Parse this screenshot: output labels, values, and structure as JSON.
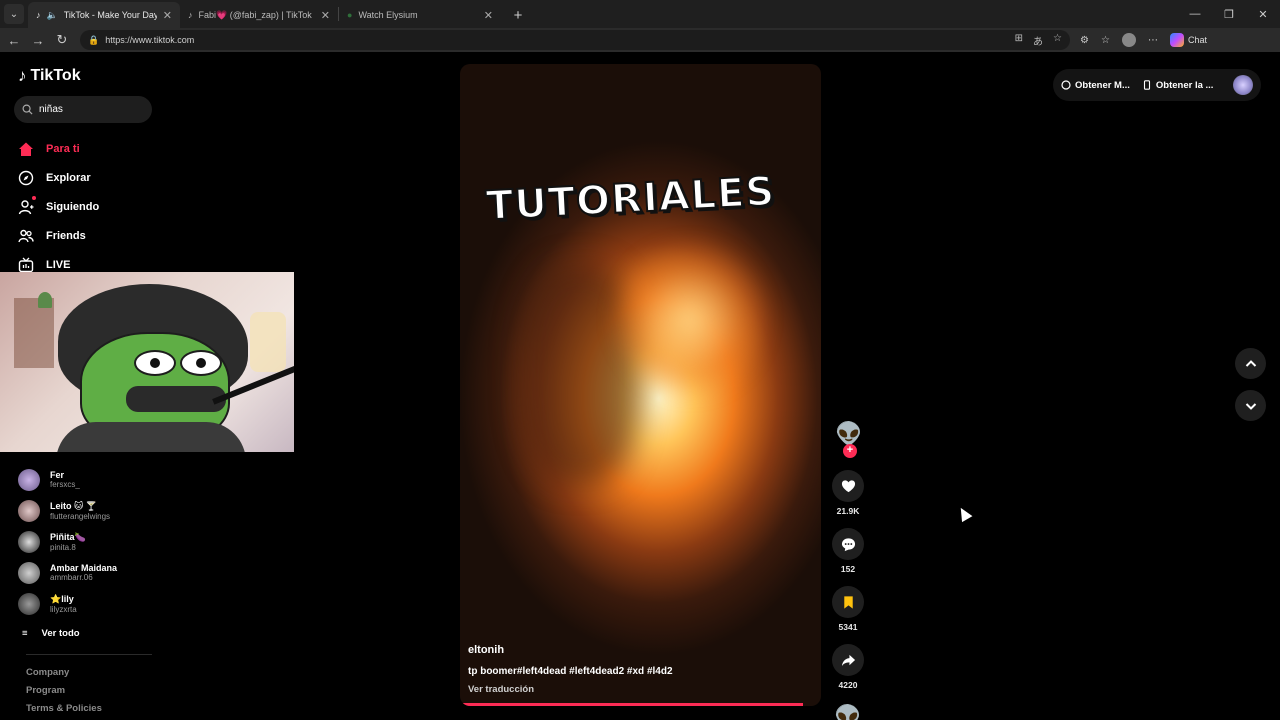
{
  "browser": {
    "tabs": [
      {
        "title": "TikTok - Make Your Day",
        "active": true
      },
      {
        "title": "Fabi💗 (@fabi_zap) | TikTok",
        "active": false
      },
      {
        "title": "Watch Elysium",
        "active": false
      }
    ],
    "url": "https://www.tiktok.com",
    "chat_label": "Chat"
  },
  "logo": {
    "text": "TikTok"
  },
  "search": {
    "value": "niñas"
  },
  "nav": {
    "items": [
      {
        "label": "Para ti",
        "icon": "home-icon",
        "active": true
      },
      {
        "label": "Explorar",
        "icon": "compass-icon"
      },
      {
        "label": "Siguiendo",
        "icon": "following-icon"
      },
      {
        "label": "Friends",
        "icon": "friends-icon"
      },
      {
        "label": "LIVE",
        "icon": "live-icon"
      }
    ]
  },
  "accounts": [
    {
      "name": "Fer",
      "handle": "fersxcs_"
    },
    {
      "name": "Leito 🐱 🍸",
      "handle": "flutterangelwings"
    },
    {
      "name": "Piñita🍆",
      "handle": "pinita.8"
    },
    {
      "name": "Ambar Maidana",
      "handle": "ammbarr.06"
    },
    {
      "name": "⭐lily",
      "handle": "lilyzxrta"
    }
  ],
  "see_all": "Ver todo",
  "footer": {
    "links": [
      "Company",
      "Program",
      "Terms & Policies"
    ]
  },
  "video": {
    "overlay_text": "TUTORIALES",
    "author": "eltonih",
    "caption": "tp boomer#left4dead #left4dead2 #xd #l4d2",
    "translate": "Ver traducción",
    "progress": 0.95
  },
  "actions": {
    "likes": "21.9K",
    "comments": "152",
    "saves": "5341",
    "shares": "4220"
  },
  "topright": {
    "btn1": "Obtener M...",
    "btn2": "Obtener la ..."
  },
  "colors": {
    "accent": "#fe2c55",
    "save_yellow": "#ffc20e"
  }
}
